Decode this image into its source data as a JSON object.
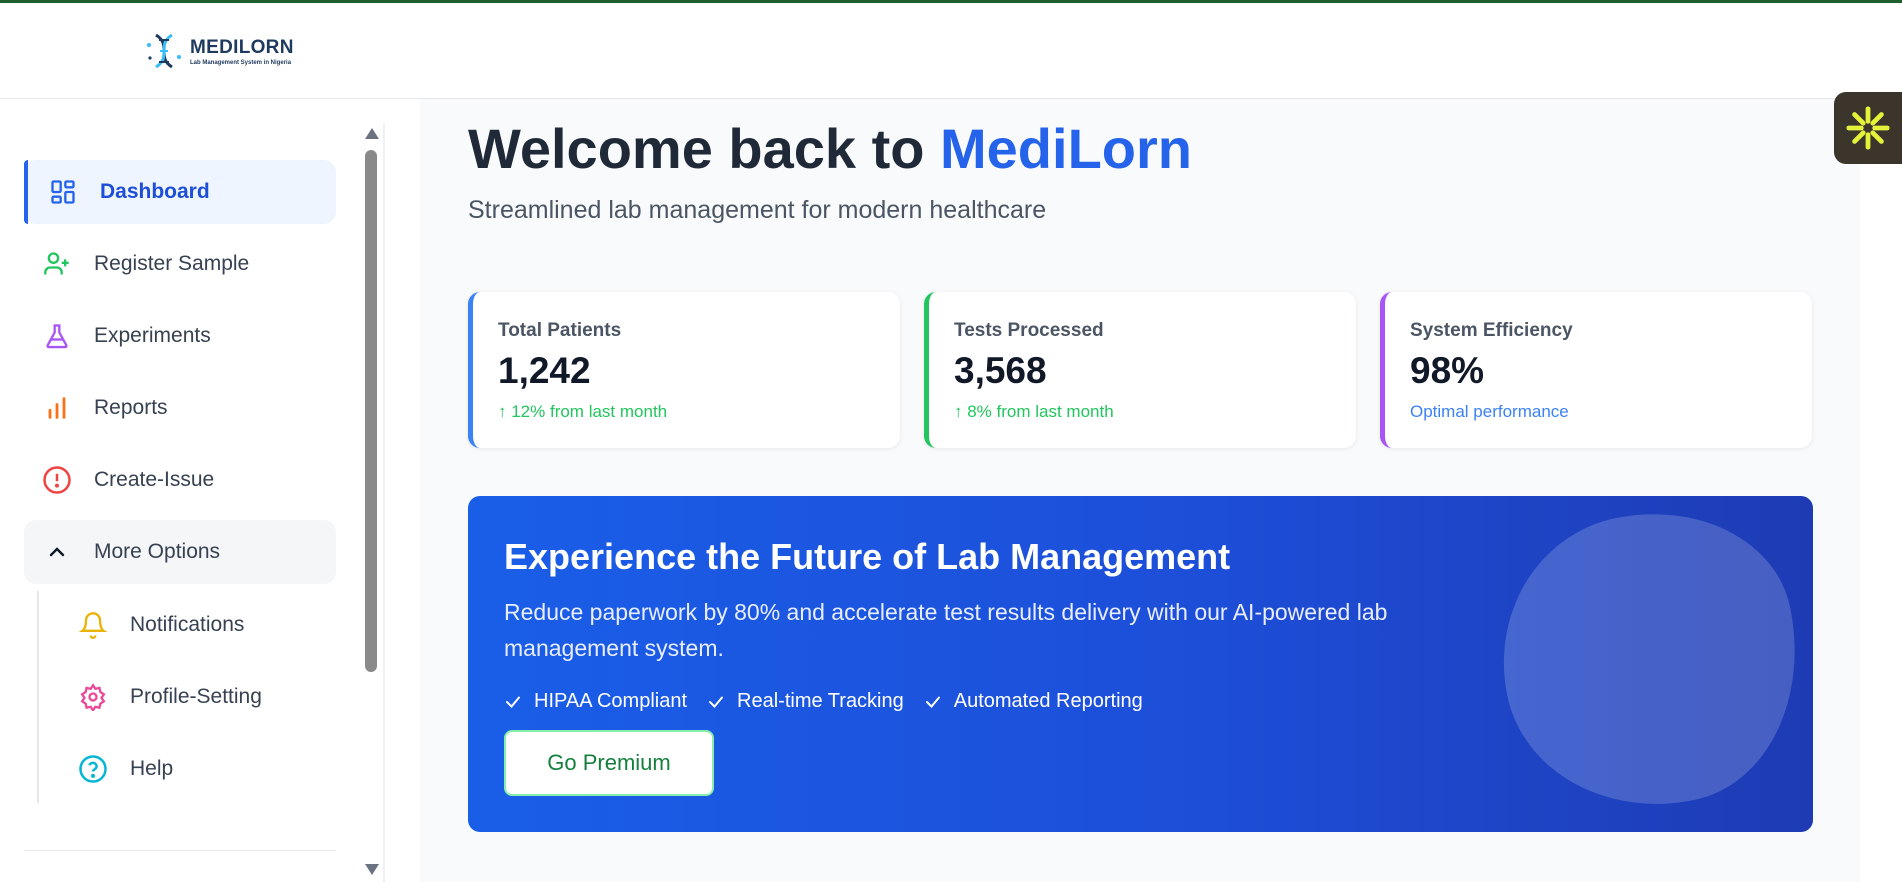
{
  "brand": {
    "name": "MEDILORN",
    "tagline": "Lab Management System in Nigeria",
    "color": "#1e3a5f"
  },
  "sidebar": {
    "items": [
      {
        "label": "Dashboard",
        "icon": "grid-icon",
        "color": "#2563eb",
        "active": true
      },
      {
        "label": "Register Sample",
        "icon": "user-plus-icon",
        "color": "#22c55e"
      },
      {
        "label": "Experiments",
        "icon": "flask-icon",
        "color": "#a855f7"
      },
      {
        "label": "Reports",
        "icon": "bar-chart-icon",
        "color": "#f97316"
      },
      {
        "label": "Create-Issue",
        "icon": "alert-circle-icon",
        "color": "#ef4444"
      }
    ],
    "more": {
      "label": "More Options",
      "icon": "chevron-up-icon",
      "expanded": true
    },
    "sub_items": [
      {
        "label": "Notifications",
        "icon": "bell-icon",
        "color": "#eab308"
      },
      {
        "label": "Profile-Setting",
        "icon": "settings-gear-icon",
        "color": "#ec4899"
      },
      {
        "label": "Help",
        "icon": "help-circle-icon",
        "color": "#06b6d4"
      }
    ]
  },
  "main": {
    "welcome_prefix": "Welcome back to ",
    "welcome_brand": "MediLorn",
    "subtitle": "Streamlined lab management for modern healthcare",
    "stats": [
      {
        "label": "Total Patients",
        "value": "1,242",
        "note": "↑ 12% from last month",
        "accent": "#3b82f6",
        "note_color": "#22c55e"
      },
      {
        "label": "Tests Processed",
        "value": "3,568",
        "note": "↑ 8% from last month",
        "accent": "#22c55e",
        "note_color": "#22c55e"
      },
      {
        "label": "System Efficiency",
        "value": "98%",
        "note": "Optimal performance",
        "accent": "#a855f7",
        "note_color": "#3b82f6"
      }
    ],
    "banner": {
      "title": "Experience the Future of Lab Management",
      "text": "Reduce paperwork by 80% and accelerate test results delivery with our AI-powered lab management system.",
      "features": [
        "HIPAA Compliant",
        "Real-time Tracking",
        "Automated Reporting"
      ],
      "button_label": "Go Premium"
    }
  },
  "widget": {
    "icon": "asterisk-logo-icon",
    "color": "#e5f23a"
  }
}
